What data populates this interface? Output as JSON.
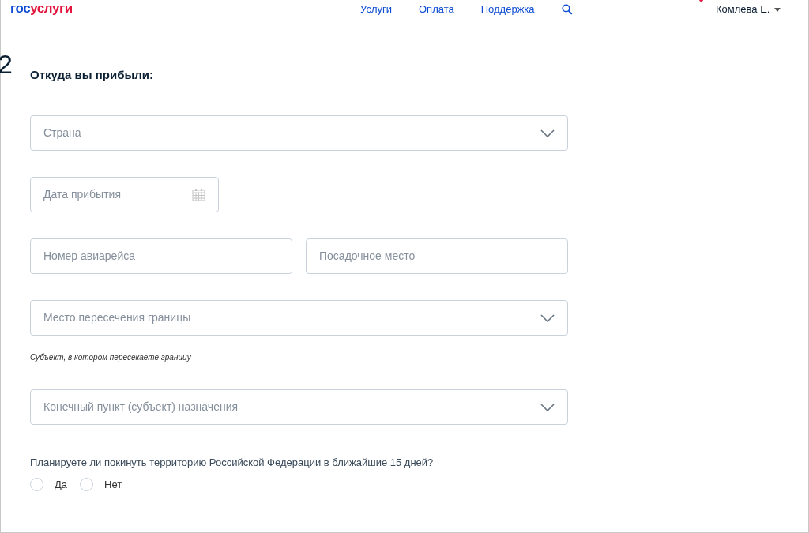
{
  "header": {
    "logo": {
      "prefix": "гос",
      "suffix": "услуги"
    },
    "nav": [
      {
        "label": "Услуги"
      },
      {
        "label": "Оплата"
      },
      {
        "label": "Поддержка"
      }
    ],
    "user": {
      "name": "Комлева Е.",
      "has_notification": true
    }
  },
  "step_number": "2",
  "section_title": "Откуда вы прибыли:",
  "rows": [
    {
      "fields": [
        {
          "kind": "select",
          "placeholder": "Страна"
        }
      ]
    },
    {
      "fields": [
        {
          "kind": "date",
          "placeholder": "Дата прибытия"
        }
      ]
    },
    {
      "fields": [
        {
          "kind": "text",
          "placeholder": "Номер авиарейса"
        },
        {
          "kind": "text",
          "placeholder": "Посадочное место"
        }
      ]
    },
    {
      "fields": [
        {
          "kind": "select",
          "placeholder": "Место пересечения границы"
        }
      ],
      "hint": "Субъект, в котором пересекаете границу"
    },
    {
      "fields": [
        {
          "kind": "select",
          "placeholder": "Конечный пункт (субъект) назначения"
        }
      ]
    }
  ],
  "question": {
    "text": "Планируете ли покинуть территорию Российской Федерации в ближайшие 15 дней?",
    "options": [
      {
        "label": "Да",
        "selected": false
      },
      {
        "label": "Нет",
        "selected": false
      }
    ]
  }
}
